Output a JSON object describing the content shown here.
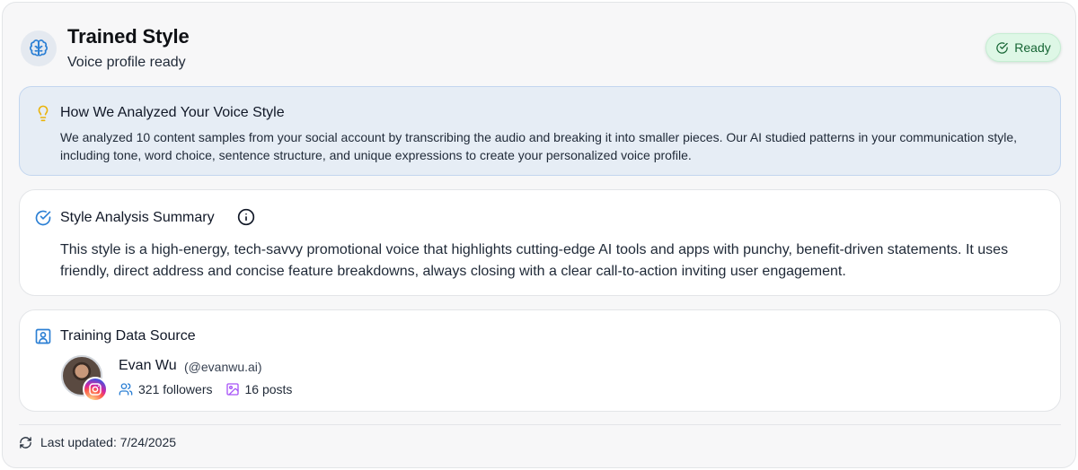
{
  "header": {
    "title": "Trained Style",
    "subtitle": "Voice profile ready",
    "icon": "brain-icon",
    "status_badge": "Ready"
  },
  "analysis": {
    "title": "How We Analyzed Your Voice Style",
    "body": "We analyzed 10 content samples from your social account by transcribing the audio and breaking it into smaller pieces. Our AI studied patterns in your communication style, including tone, word choice, sentence structure, and unique expressions to create your personalized voice profile."
  },
  "summary": {
    "title": "Style Analysis Summary",
    "body": "This style is a high-energy, tech-savvy promotional voice that highlights cutting-edge AI tools and apps with punchy, benefit-driven statements. It uses friendly, direct address and concise feature breakdowns, always closing with a clear call-to-action inviting user engagement."
  },
  "source": {
    "title": "Training Data Source",
    "name": "Evan Wu",
    "handle": "(@evanwu.ai)",
    "followers": "321 followers",
    "posts": "16 posts",
    "platform": "instagram"
  },
  "footer": {
    "last_updated": "Last updated: 7/24/2025"
  },
  "colors": {
    "accent_blue": "#2b7fd4",
    "ready_green": "#166534",
    "bulb_amber": "#eab308",
    "posts_purple": "#a855f7"
  }
}
